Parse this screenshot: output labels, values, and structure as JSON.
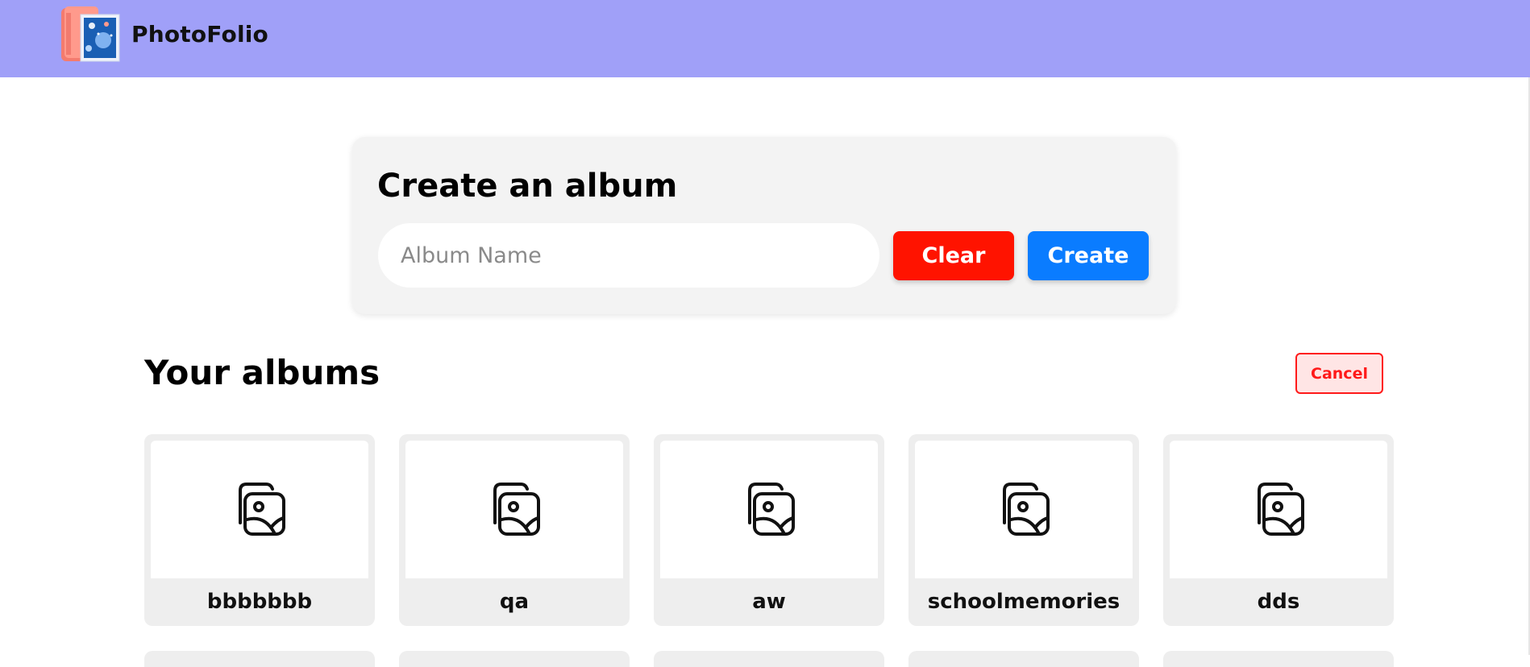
{
  "app": {
    "title": "PhotoFolio"
  },
  "create_form": {
    "heading": "Create an album",
    "input_placeholder": "Album Name",
    "input_value": "",
    "clear_label": "Clear",
    "create_label": "Create"
  },
  "albums_section": {
    "heading": "Your albums",
    "cancel_label": "Cancel",
    "albums": [
      {
        "name": "bbbbbbb"
      },
      {
        "name": "qa"
      },
      {
        "name": "aw"
      },
      {
        "name": "schoolmemories"
      },
      {
        "name": "dds"
      }
    ]
  },
  "colors": {
    "navbar": "#a0a0f8",
    "clear_button": "#ff1300",
    "create_button": "#0a7cff",
    "cancel_border": "#ff1a1a"
  },
  "icons": {
    "logo": "photo-album-logo-icon",
    "album_thumbnail": "photos-gallery-icon"
  }
}
